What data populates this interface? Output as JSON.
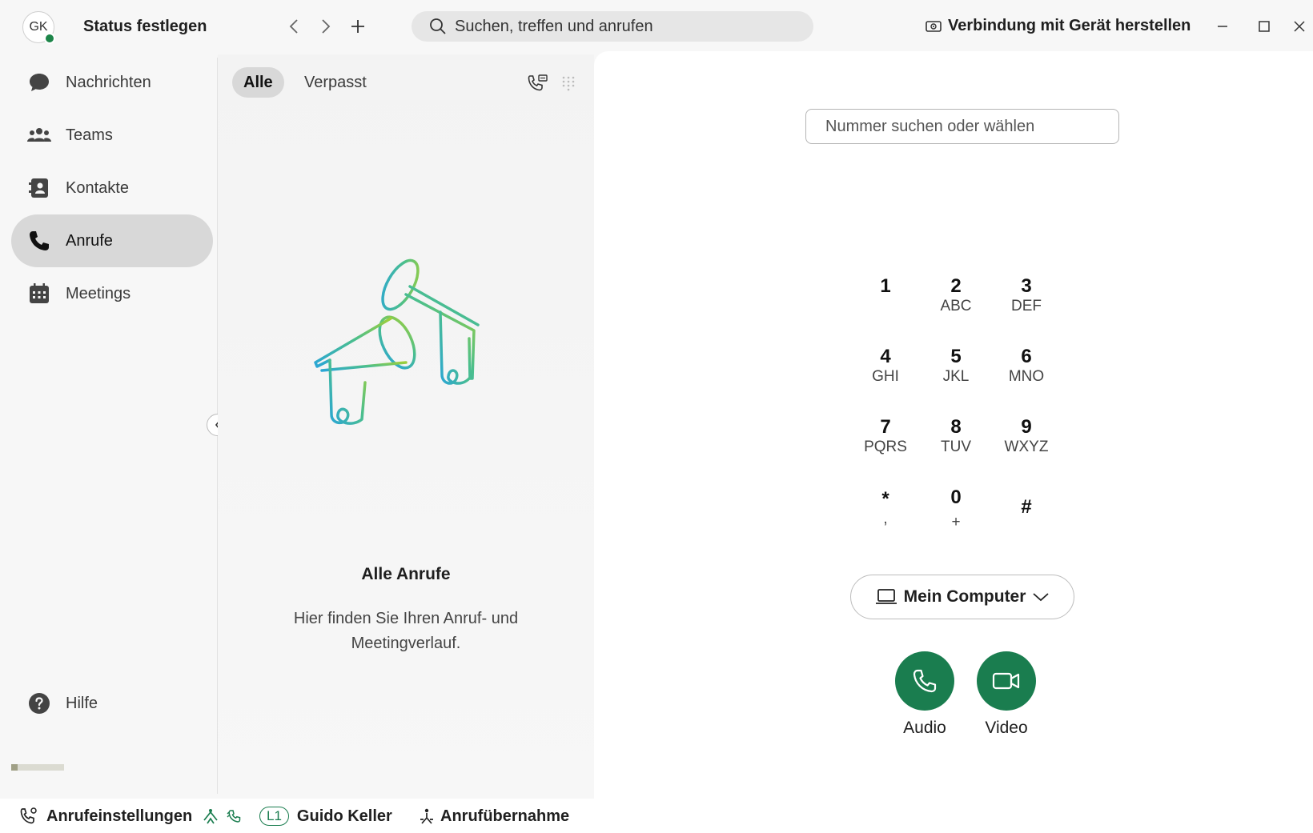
{
  "titlebar": {
    "avatar_initials": "GK",
    "status_label": "Status festlegen",
    "search_placeholder": "Suchen, treffen und anrufen",
    "connect_device": "Verbindung mit Gerät herstellen"
  },
  "sidebar": {
    "items": [
      {
        "label": "Nachrichten",
        "icon": "chat-bubble-icon"
      },
      {
        "label": "Teams",
        "icon": "people-icon"
      },
      {
        "label": "Kontakte",
        "icon": "contacts-book-icon"
      },
      {
        "label": "Anrufe",
        "icon": "phone-icon",
        "active": true
      },
      {
        "label": "Meetings",
        "icon": "calendar-icon"
      }
    ],
    "help_label": "Hilfe"
  },
  "middle": {
    "tabs": [
      {
        "label": "Alle",
        "active": true
      },
      {
        "label": "Verpasst",
        "active": false
      }
    ],
    "empty_title": "Alle Anrufe",
    "empty_desc": "Hier finden Sie Ihren Anruf- und Meetingverlauf."
  },
  "dialer": {
    "input_placeholder": "Nummer suchen oder wählen",
    "keys": [
      {
        "digit": "1",
        "letters": ""
      },
      {
        "digit": "2",
        "letters": "ABC"
      },
      {
        "digit": "3",
        "letters": "DEF"
      },
      {
        "digit": "4",
        "letters": "GHI"
      },
      {
        "digit": "5",
        "letters": "JKL"
      },
      {
        "digit": "6",
        "letters": "MNO"
      },
      {
        "digit": "7",
        "letters": "PQRS"
      },
      {
        "digit": "8",
        "letters": "TUV"
      },
      {
        "digit": "9",
        "letters": "WXYZ"
      },
      {
        "digit": "*",
        "letters": ","
      },
      {
        "digit": "0",
        "letters": "+"
      },
      {
        "digit": "#",
        "letters": ""
      }
    ],
    "device": "Mein Computer",
    "audio_label": "Audio",
    "video_label": "Video",
    "accent_color": "#1a7d4f"
  },
  "bottombar": {
    "call_settings": "Anrufeinstellungen",
    "line_badge": "L1",
    "line_user": "Guido Keller",
    "call_pickup": "Anrufübernahme"
  }
}
